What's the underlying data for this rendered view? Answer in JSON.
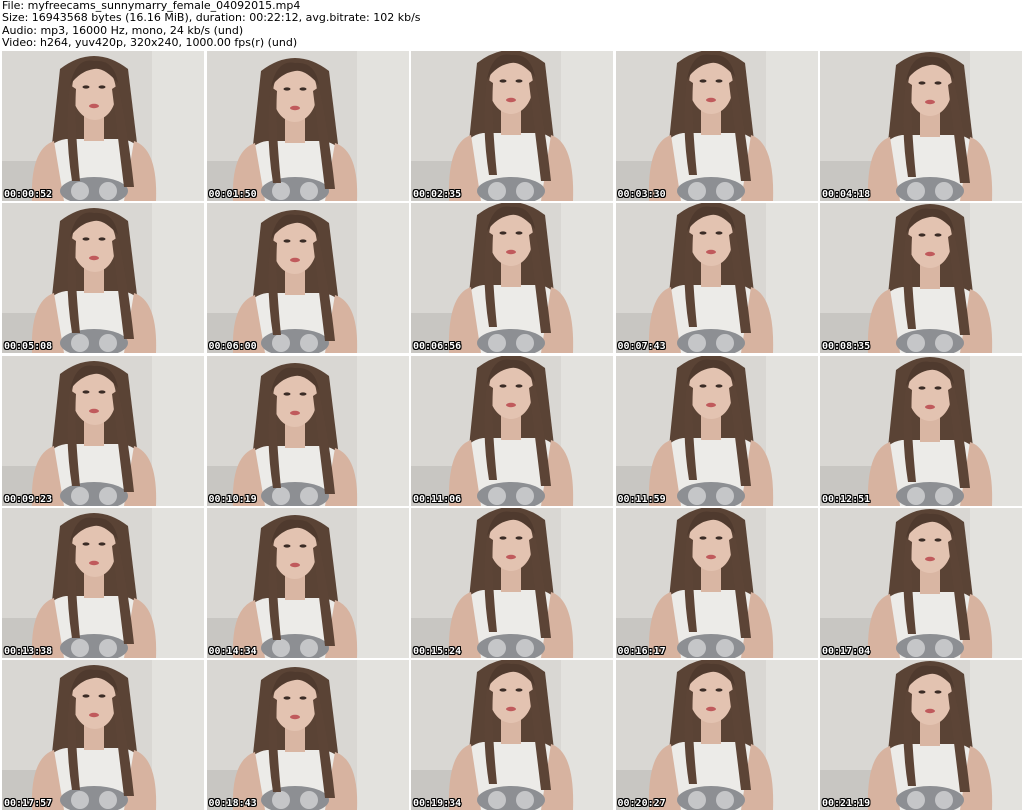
{
  "header": {
    "line1": "File: myfreecams_sunnymarry_female_04092015.mp4",
    "line2": "Size: 16943568 bytes (16.16 MiB), duration: 00:22:12, avg.bitrate: 102 kb/s",
    "line3": "Audio: mp3, 16000 Hz, mono, 24 kb/s (und)",
    "line4": "Video: h264, yuv420p, 320x240, 1000.00 fps(r) (und)"
  },
  "thumbnails": [
    {
      "timestamp": "00:00:52"
    },
    {
      "timestamp": "00:01:50"
    },
    {
      "timestamp": "00:02:35"
    },
    {
      "timestamp": "00:03:30"
    },
    {
      "timestamp": "00:04:18"
    },
    {
      "timestamp": "00:05:08"
    },
    {
      "timestamp": "00:06:00"
    },
    {
      "timestamp": "00:06:56"
    },
    {
      "timestamp": "00:07:43"
    },
    {
      "timestamp": "00:08:35"
    },
    {
      "timestamp": "00:09:23"
    },
    {
      "timestamp": "00:10:19"
    },
    {
      "timestamp": "00:11:06"
    },
    {
      "timestamp": "00:11:59"
    },
    {
      "timestamp": "00:12:51"
    },
    {
      "timestamp": "00:13:38"
    },
    {
      "timestamp": "00:14:34"
    },
    {
      "timestamp": "00:15:24"
    },
    {
      "timestamp": "00:16:17"
    },
    {
      "timestamp": "00:17:04"
    },
    {
      "timestamp": "00:17:57"
    },
    {
      "timestamp": "00:18:43"
    },
    {
      "timestamp": "00:19:34"
    },
    {
      "timestamp": "00:20:27"
    },
    {
      "timestamp": "00:21:19"
    }
  ]
}
